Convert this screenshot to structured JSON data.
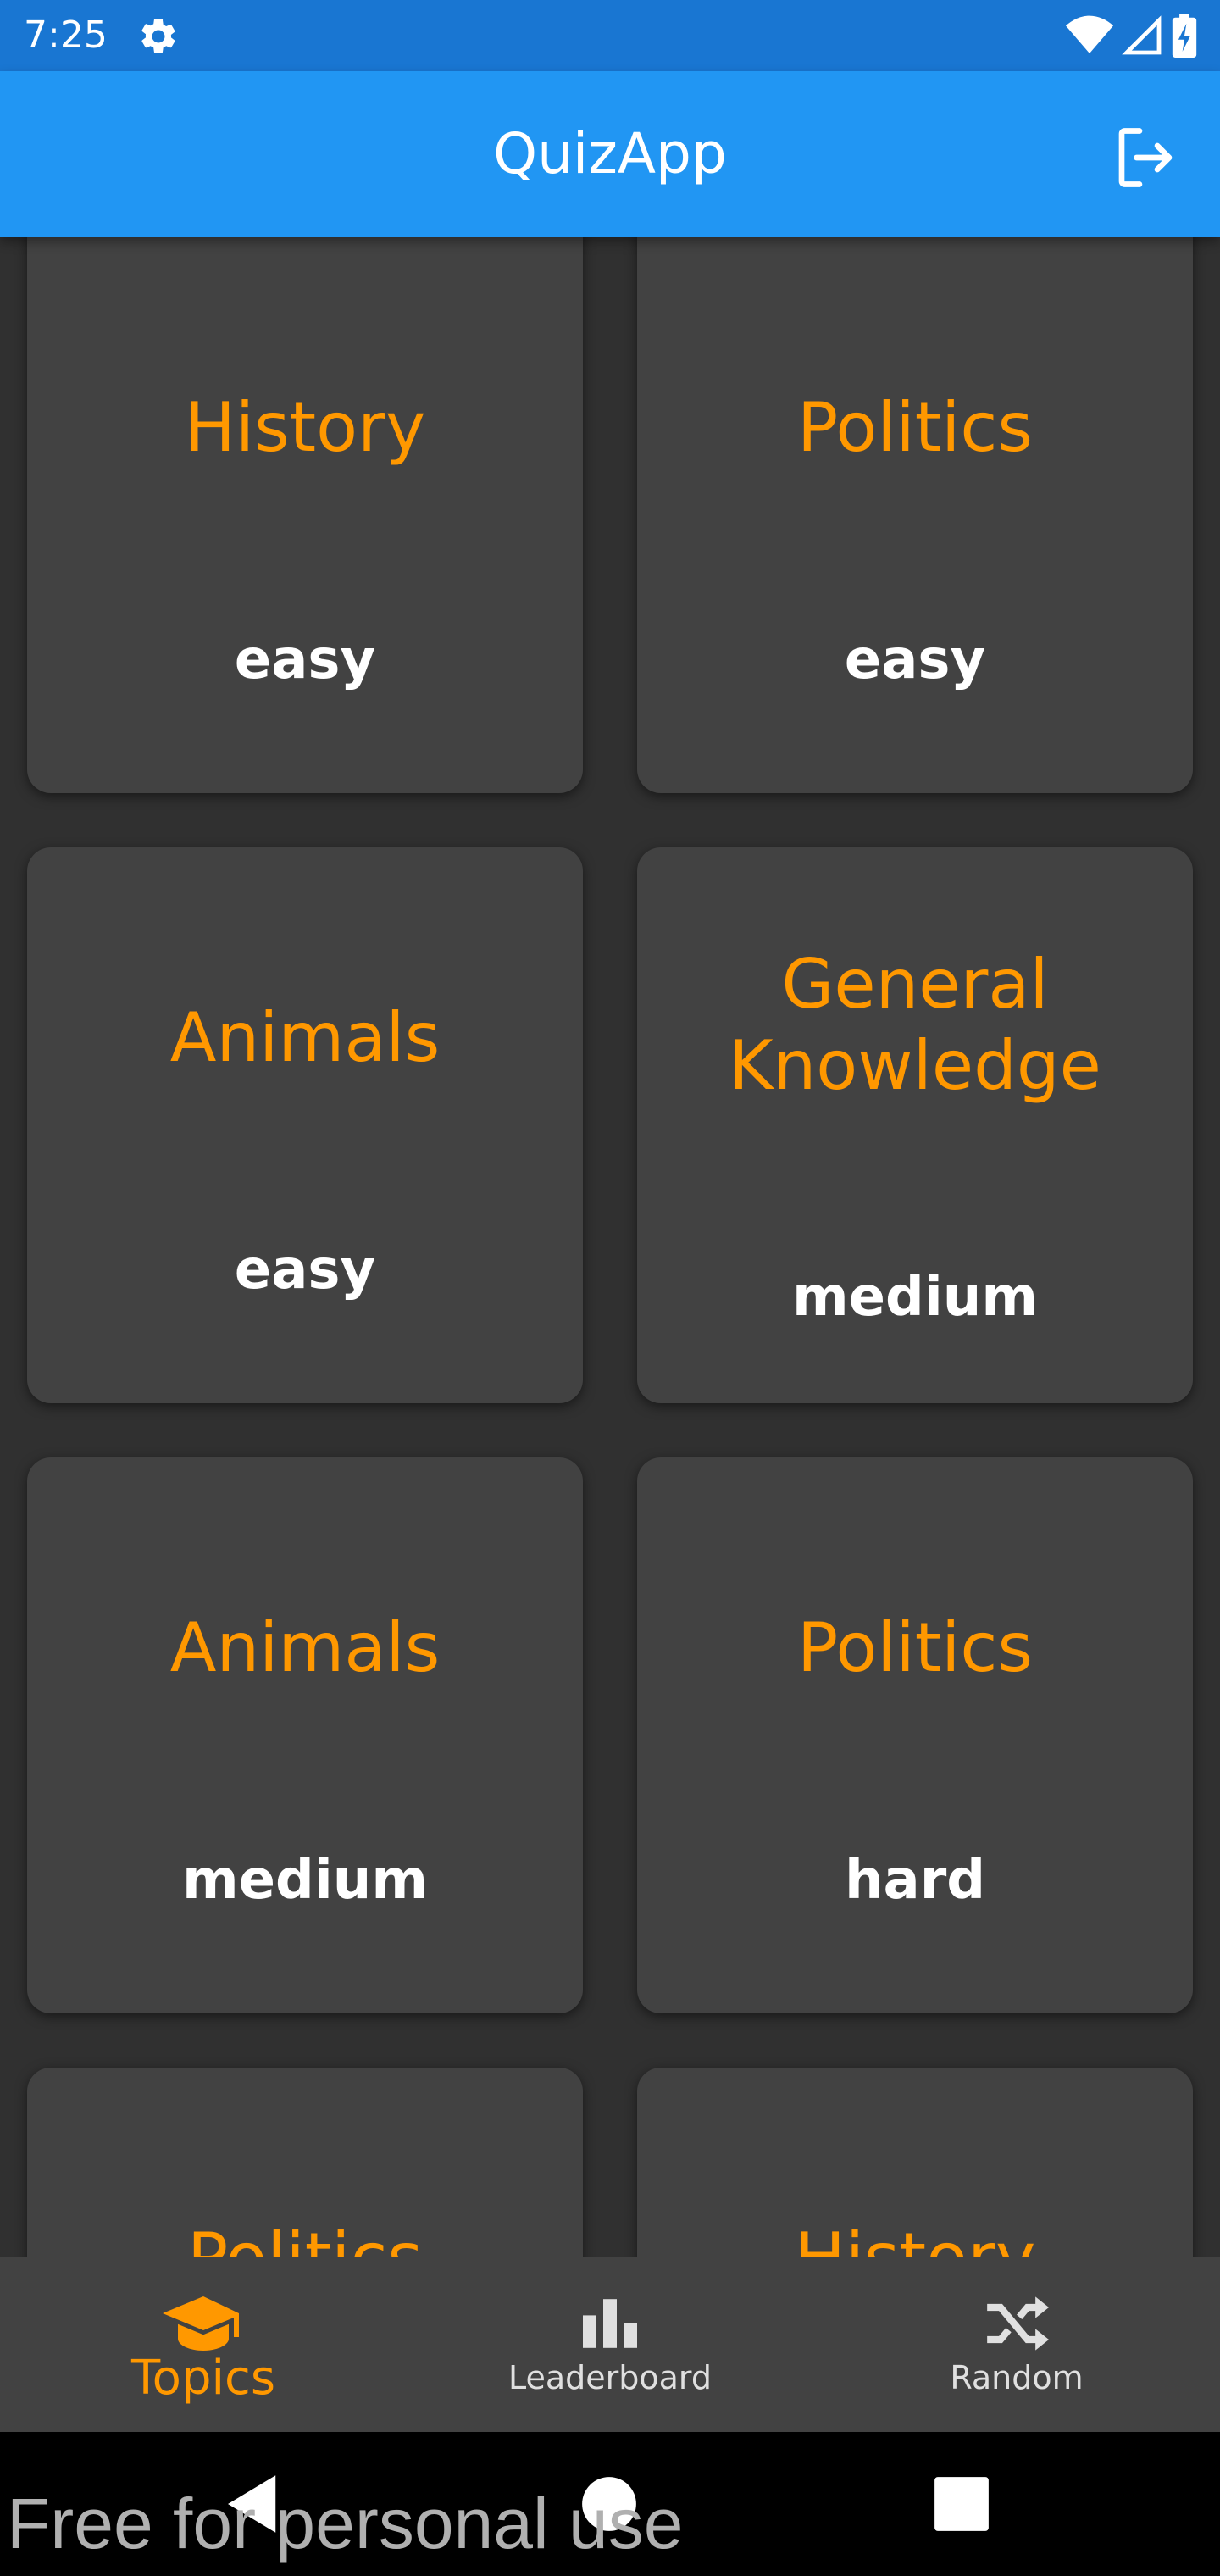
{
  "status_bar": {
    "time": "7:25",
    "icons": [
      "gear-icon",
      "wifi-icon",
      "cell-signal-icon",
      "battery-charging-icon"
    ]
  },
  "app_bar": {
    "title": "QuizApp",
    "logout_icon": "logout-icon"
  },
  "topics": [
    {
      "topic": "History",
      "difficulty": "easy"
    },
    {
      "topic": "Politics",
      "difficulty": "easy"
    },
    {
      "topic": "Animals",
      "difficulty": "easy"
    },
    {
      "topic": "General Knowledge",
      "difficulty": "medium"
    },
    {
      "topic": "Animals",
      "difficulty": "medium"
    },
    {
      "topic": "Politics",
      "difficulty": "hard"
    },
    {
      "topic": "Politics",
      "difficulty": ""
    },
    {
      "topic": "History",
      "difficulty": ""
    }
  ],
  "bottom_nav": {
    "items": [
      {
        "label": "Topics",
        "icon": "graduation-cap-icon",
        "active": true
      },
      {
        "label": "Leaderboard",
        "icon": "bar-chart-icon",
        "active": false
      },
      {
        "label": "Random",
        "icon": "shuffle-icon",
        "active": false
      }
    ]
  },
  "colors": {
    "status_bar": "#1976d2",
    "app_bar": "#2196f3",
    "background": "#303030",
    "card": "#424242",
    "accent": "#ff9800"
  },
  "watermark": "Free for personal use"
}
